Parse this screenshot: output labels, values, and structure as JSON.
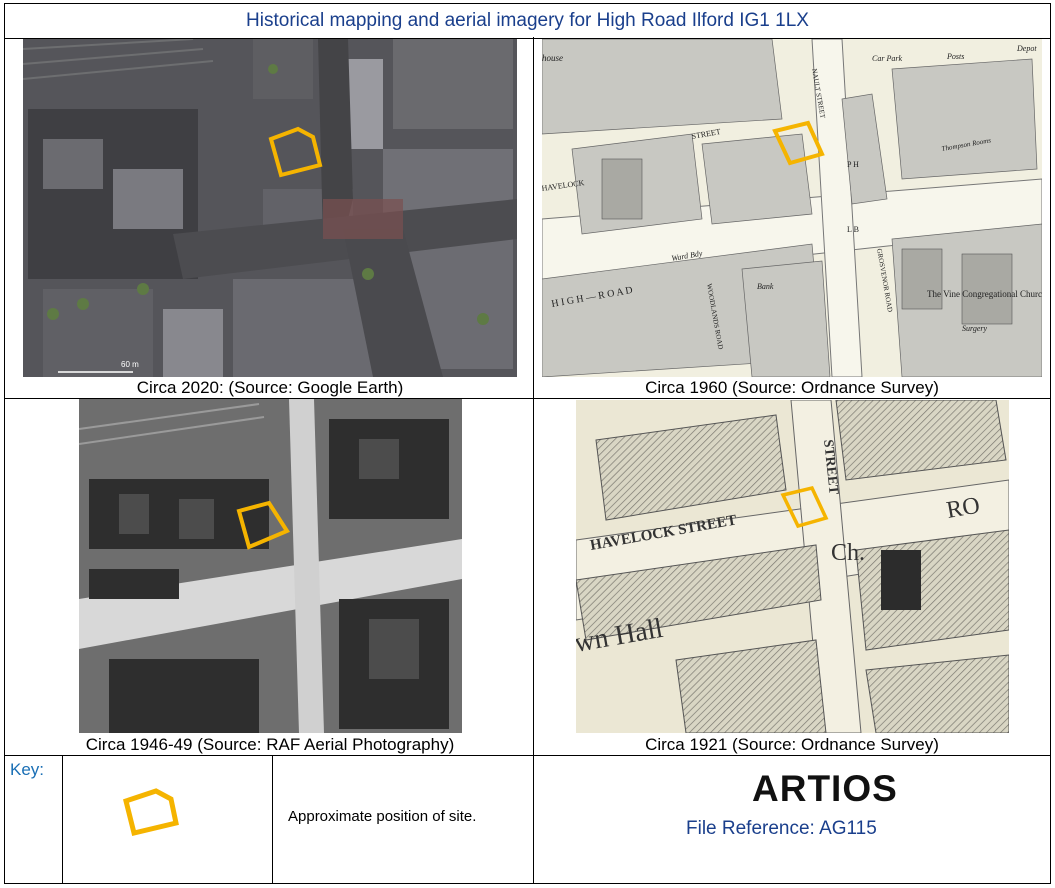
{
  "title": "Historical mapping and aerial imagery for High Road Ilford IG1 1LX",
  "panels": {
    "p2020": {
      "caption": "Circa 2020: (Source: Google Earth)",
      "scale": "60 m"
    },
    "p1960": {
      "caption": "Circa 1960 (Source: Ordnance Survey)"
    },
    "p1946": {
      "caption": "Circa 1946-49 (Source: RAF Aerial Photography)"
    },
    "p1921": {
      "caption": "Circa 1921 (Source: Ordnance Survey)"
    }
  },
  "map1960_labels": {
    "street": "STREET",
    "havelock": "HAVELOCK",
    "high_road": "H I G H — R O A D",
    "ward_bdy": "Ward Bdy",
    "woodlands": "WOODLANDS ROAD",
    "grosvenor": "GROSVENOR ROAD",
    "church": "The Vine Congregational Church",
    "surgery": "Surgery",
    "bank": "Bank",
    "car_park": "Car Park",
    "ph": "P H",
    "thompson": "Thompson Rooms",
    "lb": "L B",
    "nault": "NAULT STREET",
    "house": "house",
    "depot": "Depot",
    "posts": "Posts"
  },
  "map1921_labels": {
    "street": "HAVELOCK STREET",
    "street2": "STREET",
    "ch": "Ch.",
    "hall": "wn Hall",
    "rd": "RO"
  },
  "key": {
    "label": "Key:",
    "description": "Approximate position of site."
  },
  "brand": {
    "logo": "ARTIOS",
    "file_ref": "File Reference: AG115"
  },
  "colors": {
    "site_outline": "#f5b400",
    "title": "#1a3f8c",
    "key": "#1a6fb5"
  }
}
